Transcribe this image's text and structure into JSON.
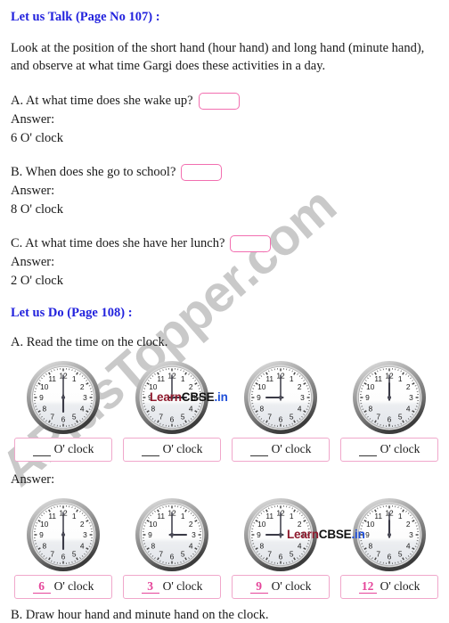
{
  "watermark": {
    "text": "APlusTopper.com"
  },
  "section1": {
    "heading": "Let us Talk (Page No 107) :",
    "intro": "Look at the position of the short hand (hour hand) and long hand (minute hand), and observe at what time Gargi does these activities in a day.",
    "questions": [
      {
        "label": "A. At what time does she wake up?",
        "answer_label": "Answer:",
        "answer": "6 O' clock",
        "input_value": ""
      },
      {
        "label": "B. When does she go to school?",
        "answer_label": "Answer:",
        "answer": "8 O' clock",
        "input_value": ""
      },
      {
        "label": "C. At what time does she have her lunch?",
        "answer_label": "Answer:",
        "answer": "2 O' clock",
        "input_value": ""
      }
    ]
  },
  "section2": {
    "heading": "Let us Do (Page 108) :",
    "subquestion_a": "A. Read the time on the clock.",
    "answer_label": "Answer:",
    "subquestion_b": "B. Draw hour hand and minute hand on the clock.",
    "clocks_blank": [
      {
        "hour": 6,
        "minute": 0,
        "box_value": "",
        "unit": "O' clock"
      },
      {
        "hour": 3,
        "minute": 0,
        "box_value": "",
        "unit": "O' clock"
      },
      {
        "hour": 9,
        "minute": 0,
        "box_value": "",
        "unit": "O' clock"
      },
      {
        "hour": 12,
        "minute": 0,
        "box_value": "",
        "unit": "O' clock"
      }
    ],
    "clocks_answer": [
      {
        "hour": 6,
        "minute": 0,
        "box_value": "6",
        "unit": "O' clock"
      },
      {
        "hour": 3,
        "minute": 0,
        "box_value": "3",
        "unit": "O' clock"
      },
      {
        "hour": 9,
        "minute": 0,
        "box_value": "9",
        "unit": "O' clock"
      },
      {
        "hour": 12,
        "minute": 0,
        "box_value": "12",
        "unit": "O' clock"
      }
    ],
    "clock_numerals": [
      "12",
      "1",
      "2",
      "3",
      "4",
      "5",
      "6",
      "7",
      "8",
      "9",
      "10",
      "11"
    ]
  },
  "branding": {
    "logo_part1": "Learn",
    "logo_part2": "CBSE",
    "logo_part3": ".in"
  },
  "colors": {
    "heading_blue": "#2222dd",
    "input_border_pink": "#f26fb0",
    "answer_box_pink": "#f0a7cb",
    "answer_ink_pink": "#e5459a",
    "watermark_gray": "#c9c9c9"
  }
}
